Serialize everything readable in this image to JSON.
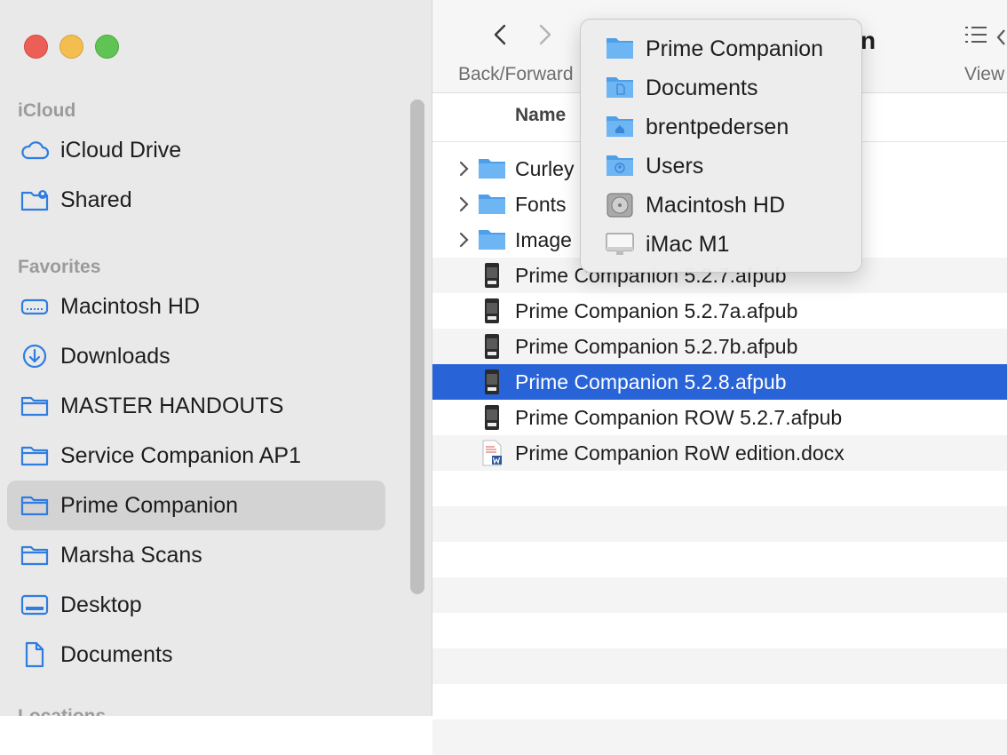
{
  "sidebar": {
    "sections": {
      "icloud": "iCloud",
      "favorites": "Favorites",
      "locations": "Locations"
    },
    "icloud_items": [
      {
        "label": "iCloud Drive",
        "icon": "cloud-icon"
      },
      {
        "label": "Shared",
        "icon": "shared-folder-icon"
      }
    ],
    "favorite_items": [
      {
        "label": "Macintosh HD",
        "icon": "hard-drive-icon"
      },
      {
        "label": "Downloads",
        "icon": "download-icon"
      },
      {
        "label": "MASTER HANDOUTS",
        "icon": "folder-icon"
      },
      {
        "label": "Service Companion AP1",
        "icon": "folder-icon"
      },
      {
        "label": "Prime Companion",
        "icon": "folder-icon",
        "selected": true
      },
      {
        "label": "Marsha Scans",
        "icon": "folder-icon"
      },
      {
        "label": "Desktop",
        "icon": "desktop-icon"
      },
      {
        "label": "Documents",
        "icon": "document-icon"
      }
    ]
  },
  "toolbar": {
    "back_forward_label": "Back/Forward",
    "view_label": "View",
    "title_fragment": "n"
  },
  "list": {
    "column_name": "Name",
    "rows": [
      {
        "name": "Curley",
        "type": "folder"
      },
      {
        "name": "Fonts",
        "type": "folder"
      },
      {
        "name": "Image",
        "type": "folder"
      },
      {
        "name": "Prime Companion 5.2.7.afpub",
        "type": "afpub"
      },
      {
        "name": "Prime Companion 5.2.7a.afpub",
        "type": "afpub"
      },
      {
        "name": "Prime Companion 5.2.7b.afpub",
        "type": "afpub"
      },
      {
        "name": "Prime Companion 5.2.8.afpub",
        "type": "afpub",
        "selected": true
      },
      {
        "name": "Prime Companion ROW 5.2.7.afpub",
        "type": "afpub"
      },
      {
        "name": "Prime Companion RoW edition.docx",
        "type": "docx"
      }
    ]
  },
  "path_menu": {
    "items": [
      {
        "label": "Prime Companion",
        "icon": "folder-icon"
      },
      {
        "label": "Documents",
        "icon": "documents-folder-icon"
      },
      {
        "label": "brentpedersen",
        "icon": "home-folder-icon"
      },
      {
        "label": "Users",
        "icon": "users-folder-icon"
      },
      {
        "label": "Macintosh HD",
        "icon": "disk-icon"
      },
      {
        "label": "iMac M1",
        "icon": "imac-icon"
      }
    ]
  },
  "colors": {
    "accent": "#2864d8",
    "sidebar_icon": "#2f7de1",
    "folder_blue": "#5aaaf0"
  }
}
